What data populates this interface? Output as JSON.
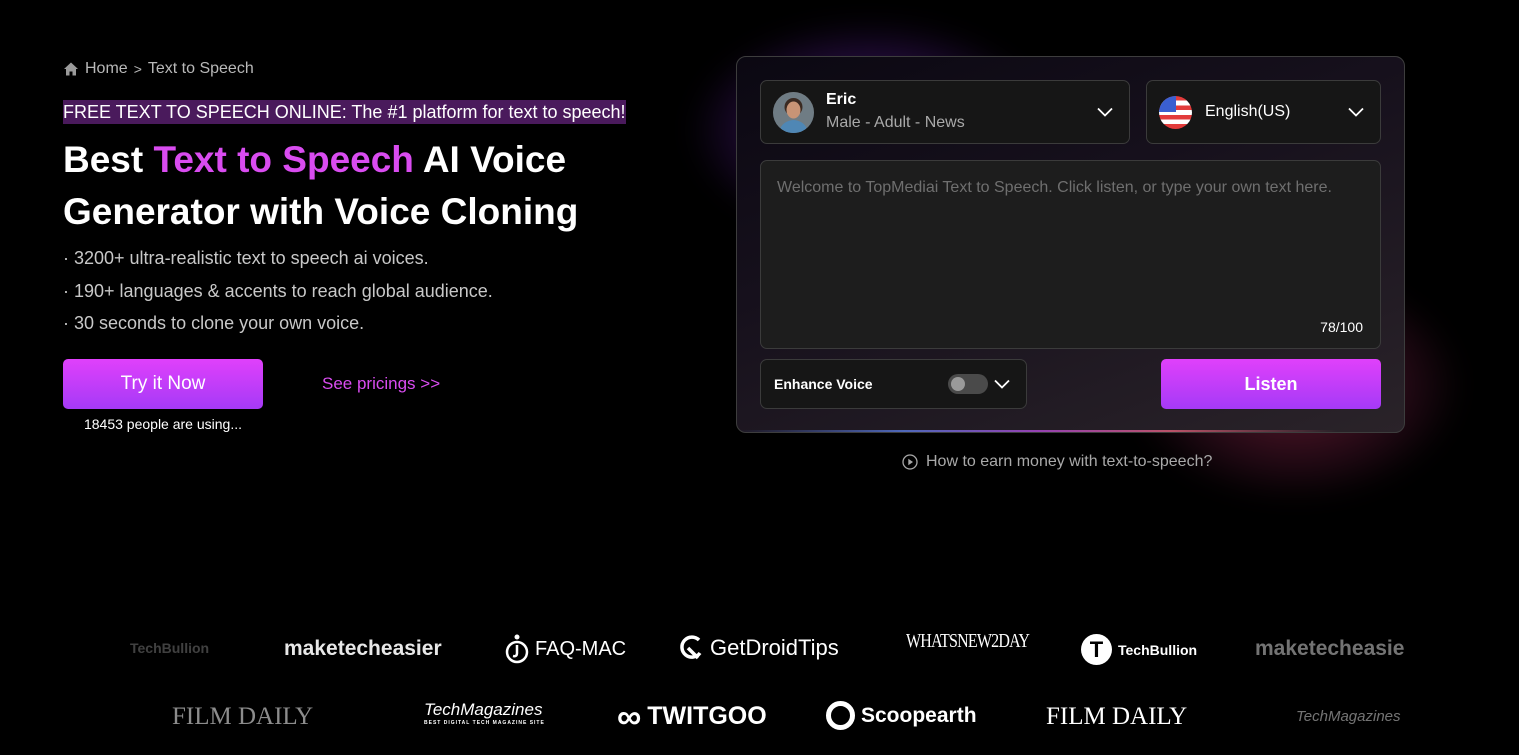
{
  "breadcrumb": {
    "home_icon": "home-icon",
    "home": "Home",
    "separator": ">",
    "current": "Text to Speech"
  },
  "hero": {
    "tagline": "FREE TEXT TO SPEECH ONLINE: The #1 platform for text to speech!",
    "headline_part1": "Best ",
    "headline_accent": "Text to Speech",
    "headline_part2": " AI Voice Generator with Voice Cloning",
    "features": [
      "· 3200+ ultra-realistic text to speech ai voices.",
      "· 190+ languages & accents to reach global audience.",
      "· 30 seconds to clone your own voice."
    ],
    "try_button": "Try it Now",
    "pricing_link": "See pricings >>",
    "people_using": "18453 people are using..."
  },
  "tts_card": {
    "voice": {
      "name": "Eric",
      "meta": "Male - Adult - News",
      "avatar_icon": "avatar-photo"
    },
    "language": {
      "label": "English(US)",
      "flag_icon": "us-flag-icon"
    },
    "text_input": {
      "placeholder": "Welcome to TopMediai Text to Speech. Click listen, or type your own text here.",
      "value": ""
    },
    "char_count": "78/100",
    "enhance_voice": {
      "label": "Enhance Voice",
      "enabled": false
    },
    "listen_button": "Listen"
  },
  "earn_link": "How to earn money with text-to-speech?",
  "media_logos": {
    "row1": [
      "TechBullion",
      "maketecheasier",
      "FAQ-MAC",
      "GetDroidTips",
      "WHATSNEW2DAY",
      "TechBullion",
      "maketecheasier"
    ],
    "row2": [
      "FILM DAILY",
      "TechMagazines",
      "TWITGOO",
      "Scoopearth",
      "FILM DAILY",
      "TechMagazines"
    ],
    "techmagazines_sub": "BEST DIGITAL TECH MAGAZINE SITE"
  },
  "colors": {
    "accent": "#d94cf0",
    "button_gradient_top": "#e040fb",
    "button_gradient_bottom": "#a53af7",
    "tagline_bg": "#4a1a5c",
    "background": "#000000"
  }
}
